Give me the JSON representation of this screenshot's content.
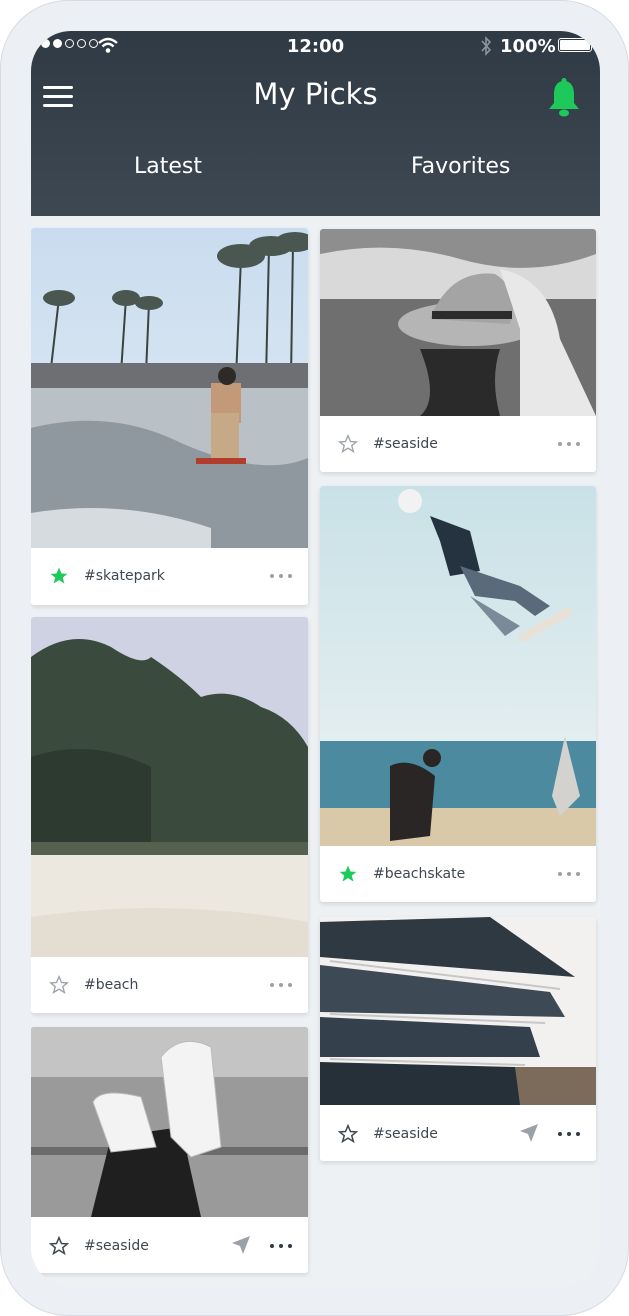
{
  "status_bar": {
    "time": "12:00",
    "battery": "100%"
  },
  "header": {
    "title": "My Picks",
    "tabs": [
      {
        "label": "Latest"
      },
      {
        "label": "Favorites"
      }
    ]
  },
  "colors": {
    "accent": "#1ec95c",
    "header_bg": "#333d47"
  },
  "cards": [
    {
      "tag": "#skatepark",
      "starred": true
    },
    {
      "tag": "#beach",
      "starred": false
    },
    {
      "tag": "#seaside",
      "starred": false
    },
    {
      "tag": "#seaside",
      "starred": false
    },
    {
      "tag": "#beachskate",
      "starred": true
    },
    {
      "tag": "#seaside",
      "starred": false
    }
  ]
}
